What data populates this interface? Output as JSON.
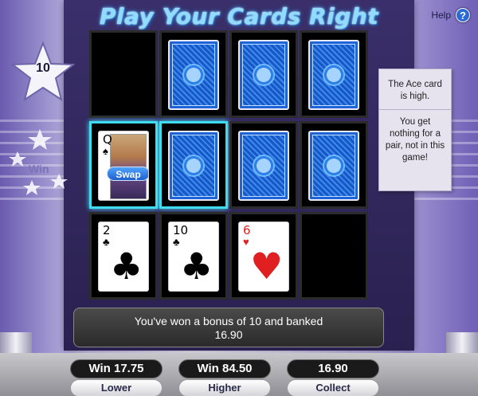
{
  "title": "Play Your Cards Right",
  "help": {
    "label": "Help",
    "icon": "?"
  },
  "star_value": "10",
  "win_label": "Win",
  "info": {
    "line1": "The Ace card is high.",
    "line2": "You get nothing for a pair, not in this game!"
  },
  "colors": {
    "selected_border": "#3fdcef",
    "card_back": "#1e64d8"
  },
  "grid": {
    "row1": [
      {
        "type": "empty"
      },
      {
        "type": "back"
      },
      {
        "type": "back"
      },
      {
        "type": "back"
      }
    ],
    "row2": [
      {
        "type": "face",
        "rank": "Q",
        "suit": "♠",
        "icon": "queen-of-spades",
        "selected": true,
        "swap_label": "Swap"
      },
      {
        "type": "back",
        "selected": true
      },
      {
        "type": "back"
      },
      {
        "type": "back"
      }
    ],
    "row3": [
      {
        "type": "face",
        "rank": "2",
        "suit": "♣",
        "color": "black"
      },
      {
        "type": "face",
        "rank": "10",
        "suit": "♣",
        "color": "black"
      },
      {
        "type": "face",
        "rank": "6",
        "suit": "♥",
        "color": "red"
      },
      {
        "type": "empty"
      }
    ]
  },
  "message": {
    "line1": "You've won a bonus of 10 and banked",
    "line2": "16.90"
  },
  "buttons": {
    "lower_value": "Win 17.75",
    "lower_label": "Lower",
    "higher_value": "Win 84.50",
    "higher_label": "Higher",
    "collect_value": "16.90",
    "collect_label": "Collect"
  }
}
